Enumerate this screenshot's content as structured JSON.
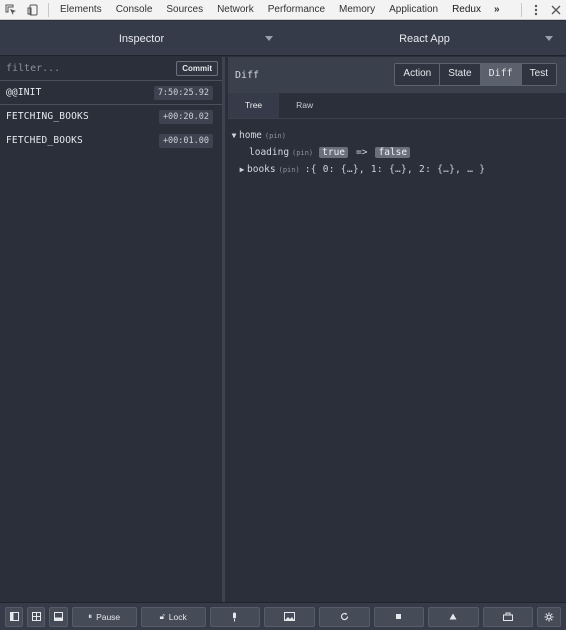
{
  "devtools": {
    "tabs": [
      "Elements",
      "Console",
      "Sources",
      "Network",
      "Performance",
      "Memory",
      "Application",
      "Redux"
    ],
    "more": "»"
  },
  "header": {
    "left_select": "Inspector",
    "right_select": "React App"
  },
  "filter": {
    "placeholder": "filter...",
    "commit_label": "Commit"
  },
  "actions": [
    {
      "name": "@@INIT",
      "time": "7:50:25.92"
    },
    {
      "name": "FETCHING_BOOKS",
      "time": "+00:20.02"
    },
    {
      "name": "FETCHED_BOOKS",
      "time": "+00:01.00"
    }
  ],
  "inspector": {
    "title": "Diff",
    "tabs": [
      "Action",
      "State",
      "Diff",
      "Test"
    ],
    "active_tab": "Diff",
    "subtabs": [
      "Tree",
      "Raw"
    ],
    "active_subtab": "Tree"
  },
  "tree": {
    "root_key": "home",
    "root_pin": "(pin)",
    "loading_key": "loading",
    "loading_pin": "(pin)",
    "loading_old": "true",
    "diff_arrow": "=>",
    "loading_new": "false",
    "books_key": "books",
    "books_pin": "(pin)",
    "books_preview": ":{ 0: {…}, 1: {…}, 2: {…}, … }"
  },
  "bottom": {
    "pause_label": "Pause",
    "lock_label": "Lock"
  }
}
